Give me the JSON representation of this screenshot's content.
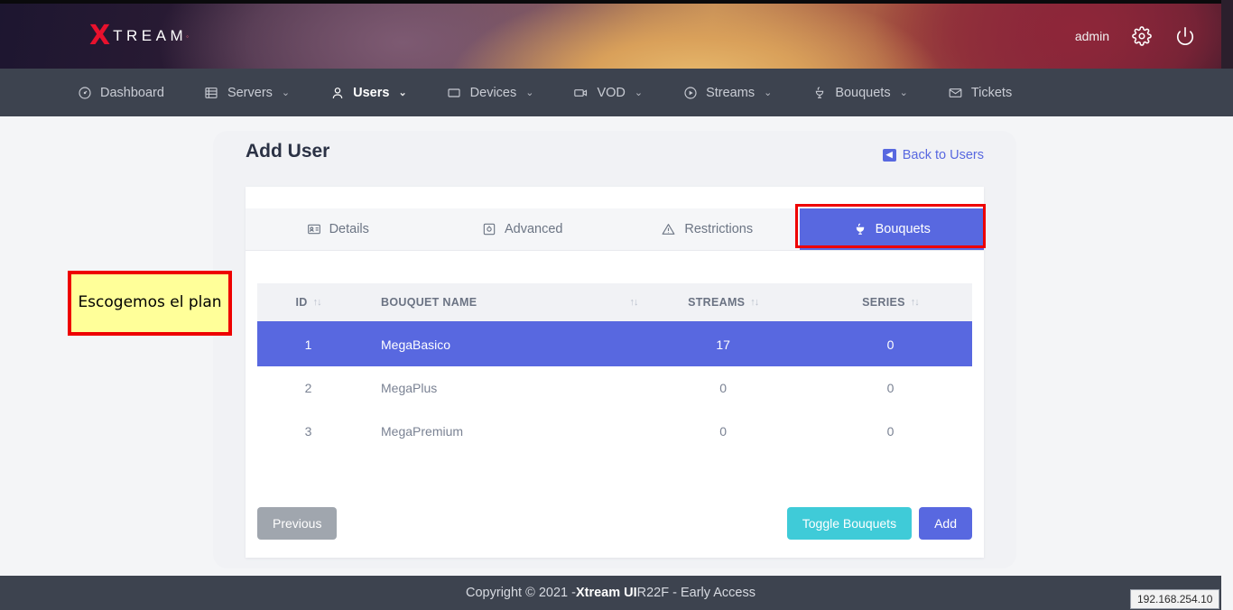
{
  "header": {
    "brand_x": "X",
    "brand_rest": "TREAM",
    "brand_sup": "◦",
    "user": "admin",
    "gear_icon": "gear-icon",
    "power_icon": "power-icon"
  },
  "nav": {
    "items": [
      {
        "label": "Dashboard",
        "icon": "dashboard-icon",
        "has_caret": false,
        "active": false
      },
      {
        "label": "Servers",
        "icon": "servers-icon",
        "has_caret": true,
        "active": false
      },
      {
        "label": "Users",
        "icon": "user-icon",
        "has_caret": true,
        "active": true
      },
      {
        "label": "Devices",
        "icon": "device-icon",
        "has_caret": true,
        "active": false
      },
      {
        "label": "VOD",
        "icon": "video-icon",
        "has_caret": true,
        "active": false
      },
      {
        "label": "Streams",
        "icon": "play-icon",
        "has_caret": true,
        "active": false
      },
      {
        "label": "Bouquets",
        "icon": "flower-icon",
        "has_caret": true,
        "active": false
      },
      {
        "label": "Tickets",
        "icon": "envelope-icon",
        "has_caret": false,
        "active": false
      }
    ]
  },
  "page": {
    "title": "Add User",
    "back_link": "Back to Users",
    "back_icon": "back-arrow-icon"
  },
  "tabs": [
    {
      "label": "Details",
      "icon": "id-card-icon",
      "active": false
    },
    {
      "label": "Advanced",
      "icon": "sliders-icon",
      "active": false
    },
    {
      "label": "Restrictions",
      "icon": "warning-icon",
      "active": false
    },
    {
      "label": "Bouquets",
      "icon": "flower-icon",
      "active": true
    }
  ],
  "table": {
    "columns": [
      "ID",
      "BOUQUET NAME",
      "STREAMS",
      "SERIES"
    ],
    "sort_icon": "sort-arrows-icon",
    "rows": [
      {
        "id": "1",
        "name": "MegaBasico",
        "streams": "17",
        "series": "0",
        "selected": true
      },
      {
        "id": "2",
        "name": "MegaPlus",
        "streams": "0",
        "series": "0",
        "selected": false
      },
      {
        "id": "3",
        "name": "MegaPremium",
        "streams": "0",
        "series": "0",
        "selected": false
      }
    ]
  },
  "actions": {
    "previous": "Previous",
    "toggle_bouquets": "Toggle Bouquets",
    "add": "Add"
  },
  "annotation": {
    "text": "Escogemos el plan"
  },
  "footer": {
    "prefix": "Copyright © 2021 - ",
    "brand": "Xtream UI",
    "suffix": " R22F - Early Access"
  },
  "ip_badge": "192.168.254.10",
  "colors": {
    "accent_blue": "#5868e0",
    "teal": "#3fcbd8",
    "gray_btn": "#a0a6ae",
    "nav_bg": "#3d434f",
    "annotation_bg": "#ffff99",
    "annotation_border": "#ee0000",
    "brand_red": "#e8112d"
  }
}
